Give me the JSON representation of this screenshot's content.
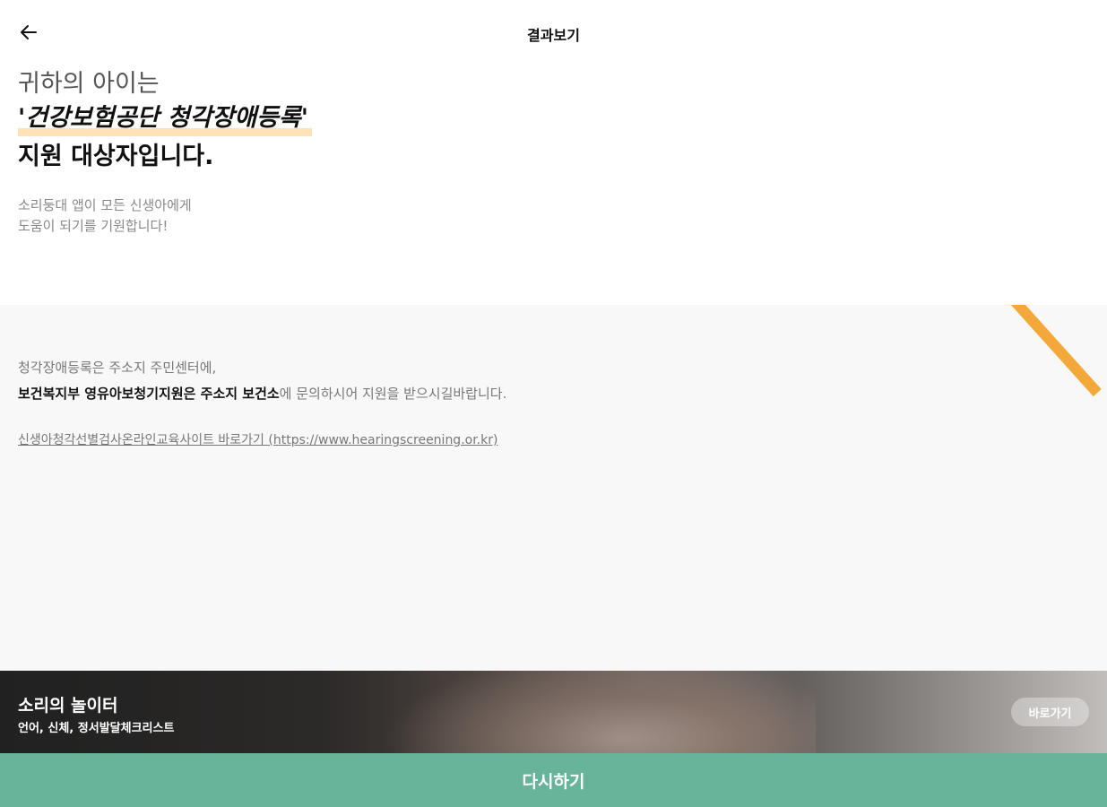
{
  "header": {
    "title": "결과보기",
    "back_icon": "arrow-left-icon"
  },
  "hero": {
    "line1": "귀하의 아이는",
    "line2": "'건강보험공단 청각장애등록'",
    "line3": "지원 대상자입니다.",
    "sub_line1": "소리둥대 앱이 모든 신생아에게",
    "sub_line2": "도움이 되기를 기원합니다!",
    "highlight_color": "#ffe3b8"
  },
  "info": {
    "line1": "청각장애등록은 주소지 주민센터에,",
    "line2_strong1": "보건복지부 영유아보청기지원은 주소지 보건소",
    "line2_rest": "에 문의하시어 지원을 받으시길바랍니다.",
    "link": "신생아청각선별검사온라인교육사이트 바로가기 (https://www.hearingscreening.or.kr)",
    "accent_color": "#f4a83a"
  },
  "banner": {
    "title": "소리의 놀이터",
    "subtitle": "언어, 신체, 정서발달체크리스트",
    "button_label": "바로가기"
  },
  "footer": {
    "retry_label": "다시하기",
    "color": "#67b49b"
  }
}
